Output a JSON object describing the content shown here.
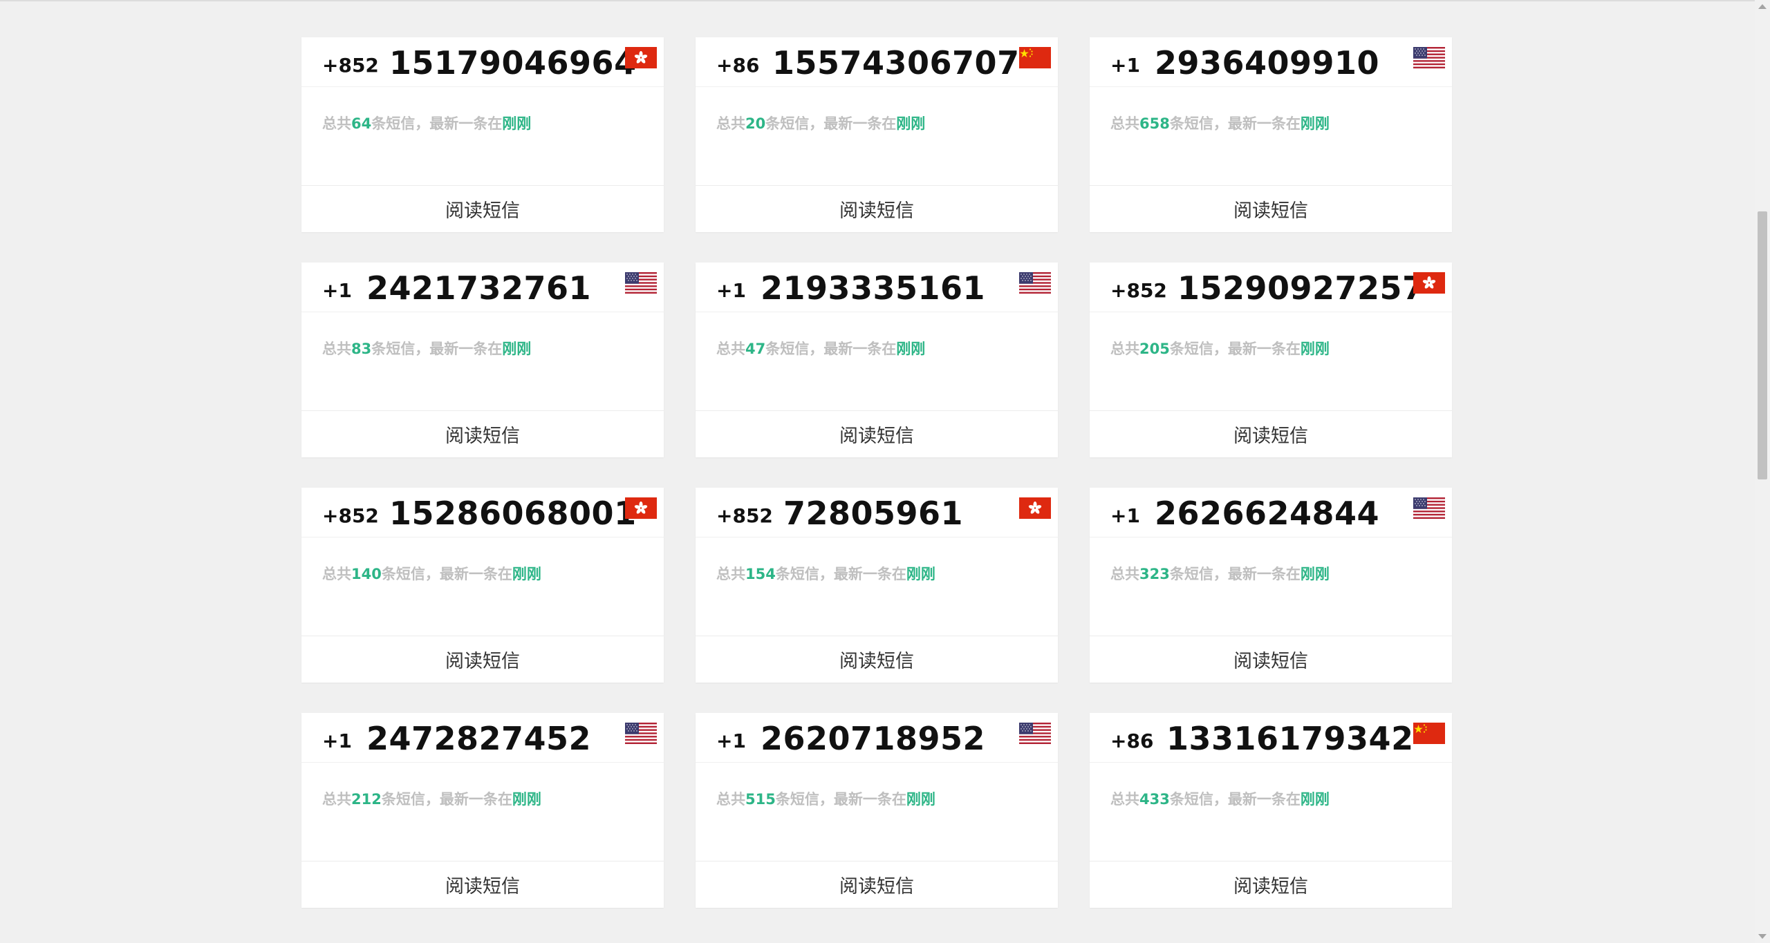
{
  "footer_label": "阅读短信",
  "info_prefix": "总共",
  "info_middle": "条短信，最新一条在",
  "info_latest": "刚刚",
  "colors": {
    "page_bg": "#f0f0f0",
    "card_bg": "#ffffff",
    "highlight": "#2db587",
    "muted_text": "#bfbfbf"
  },
  "cards": [
    {
      "code": "+852",
      "number": "15179046964",
      "count": "64",
      "flag": "hong-kong-flag-icon"
    },
    {
      "code": "+86",
      "number": "15574306707",
      "count": "20",
      "flag": "china-flag-icon"
    },
    {
      "code": "+1",
      "number": "2936409910",
      "count": "658",
      "flag": "usa-flag-icon"
    },
    {
      "code": "+1",
      "number": "2421732761",
      "count": "83",
      "flag": "usa-flag-icon"
    },
    {
      "code": "+1",
      "number": "2193335161",
      "count": "47",
      "flag": "usa-flag-icon"
    },
    {
      "code": "+852",
      "number": "15290927257",
      "count": "205",
      "flag": "hong-kong-flag-icon"
    },
    {
      "code": "+852",
      "number": "15286068001",
      "count": "140",
      "flag": "hong-kong-flag-icon"
    },
    {
      "code": "+852",
      "number": "72805961",
      "count": "154",
      "flag": "hong-kong-flag-icon"
    },
    {
      "code": "+1",
      "number": "2626624844",
      "count": "323",
      "flag": "usa-flag-icon"
    },
    {
      "code": "+1",
      "number": "2472827452",
      "count": "212",
      "flag": "usa-flag-icon"
    },
    {
      "code": "+1",
      "number": "2620718952",
      "count": "515",
      "flag": "usa-flag-icon"
    },
    {
      "code": "+86",
      "number": "13316179342",
      "count": "433",
      "flag": "china-flag-icon"
    }
  ]
}
